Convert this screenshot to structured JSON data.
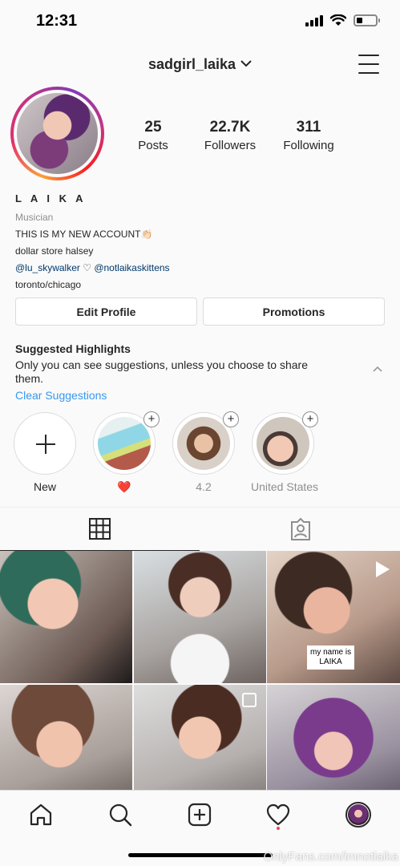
{
  "status_bar": {
    "time": "12:31"
  },
  "header": {
    "username": "sadgirl_laika"
  },
  "profile": {
    "stats": [
      {
        "num": "25",
        "label": "Posts"
      },
      {
        "num": "22.7K",
        "label": "Followers"
      },
      {
        "num": "311",
        "label": "Following"
      }
    ],
    "name": "L A I K A",
    "category": "Musician",
    "bio_line1": "THIS IS MY NEW ACCOUNT👏🏻",
    "bio_line2": "dollar store halsey",
    "bio_link1": "@lu_skywalker",
    "bio_heart": " ♡ ",
    "bio_link2": "@notlaikaskittens",
    "location": "toronto/chicago"
  },
  "buttons": {
    "edit_profile": "Edit Profile",
    "promotions": "Promotions"
  },
  "suggested": {
    "title": "Suggested Highlights",
    "description": "Only you can see suggestions, unless you choose to share them.",
    "clear": "Clear Suggestions"
  },
  "highlights": [
    {
      "label": "New"
    },
    {
      "label": "❤️"
    },
    {
      "label": "4.2"
    },
    {
      "label": "United States"
    }
  ],
  "grid": {
    "overlay_text_line1": "my name is",
    "overlay_text_line2": "LAIKA"
  },
  "watermark": "OnlyFans.com/imnotlaika",
  "colors": {
    "link": "#00376b",
    "accent_blue": "#3897f0",
    "notification": "#ed4956"
  }
}
